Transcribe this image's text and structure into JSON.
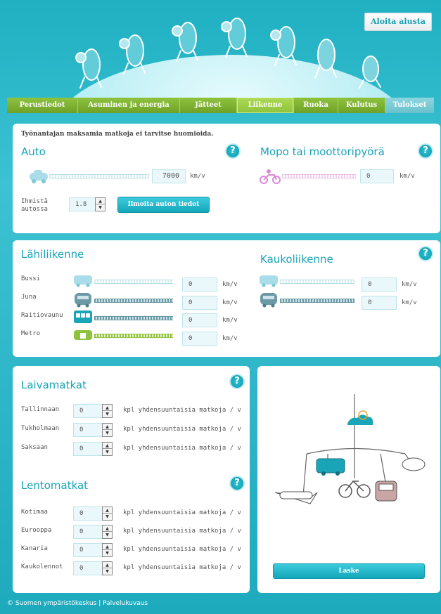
{
  "header": {
    "restart_label": "Aloita alusta"
  },
  "tabs": [
    {
      "label": "Perustiedot"
    },
    {
      "label": "Asuminen ja energia"
    },
    {
      "label": "Jätteet"
    },
    {
      "label": "Liikenne"
    },
    {
      "label": "Ruoka"
    },
    {
      "label": "Kulutus"
    },
    {
      "label": "Tulokset"
    }
  ],
  "car_panel": {
    "note": "Työnantajan maksamia matkoja ei tarvitse huomioida.",
    "car_title": "Auto",
    "car_value": "7000",
    "car_unit": "km/v",
    "people_label": "Ihmistä autossa",
    "people_value": "1.8",
    "car_details_button": "Ilmoita auton tiedot",
    "moto_title": "Mopo tai moottoripyörä",
    "moto_value": "0",
    "moto_unit": "km/v",
    "help": "?"
  },
  "transit_panel": {
    "local_title": "Lähiliikenne",
    "long_title": "Kaukoliikenne",
    "help": "?",
    "local_rows": [
      {
        "label": "Bussi",
        "value": "0",
        "unit": "km/v"
      },
      {
        "label": "Juna",
        "value": "0",
        "unit": "km/v"
      },
      {
        "label": "Raitiovaunu",
        "value": "0",
        "unit": "km/v"
      },
      {
        "label": "Metro",
        "value": "0",
        "unit": "km/v"
      }
    ],
    "long_rows": [
      {
        "value": "0",
        "unit": "km/v"
      },
      {
        "value": "0",
        "unit": "km/v"
      }
    ]
  },
  "trips_panel": {
    "ship_title": "Laivamatkat",
    "flight_title": "Lentomatkat",
    "help": "?",
    "ship_rows": [
      {
        "label": "Tallinnaan",
        "value": "0",
        "suffix": "kpl yhdensuuntaisia matkoja / v"
      },
      {
        "label": "Tukholmaan",
        "value": "0",
        "suffix": "kpl yhdensuuntaisia matkoja / v"
      },
      {
        "label": "Saksaan",
        "value": "0",
        "suffix": "kpl yhdensuuntaisia matkoja / v"
      }
    ],
    "flight_rows": [
      {
        "label": "Kotimaa",
        "value": "0",
        "suffix": "kpl yhdensuuntaisia matkoja / v"
      },
      {
        "label": "Eurooppa",
        "value": "0",
        "suffix": "kpl yhdensuuntaisia matkoja / v"
      },
      {
        "label": "Kanaria",
        "value": "0",
        "suffix": "kpl yhdensuuntaisia matkoja / v"
      },
      {
        "label": "Kaukolennot",
        "value": "0",
        "suffix": "kpl yhdensuuntaisia matkoja / v"
      }
    ]
  },
  "illus_panel": {
    "calculate_label": "Laske"
  },
  "footer": {
    "text": "© Suomen ympäristökeskus | Palvelukuvaus"
  }
}
